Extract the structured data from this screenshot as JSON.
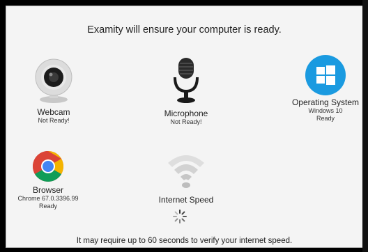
{
  "title": "Examity will ensure your computer is ready.",
  "checks": {
    "webcam": {
      "label": "Webcam",
      "status": "Not Ready!"
    },
    "microphone": {
      "label": "Microphone",
      "status": "Not Ready!"
    },
    "os": {
      "label": "Operating System",
      "detail": "Windows 10",
      "status": "Ready"
    },
    "browser": {
      "label": "Browser",
      "detail": "Chrome 67.0.3396.99",
      "status": "Ready"
    },
    "internet": {
      "label": "Internet Speed"
    }
  },
  "footer": "It may require up to 60 seconds to verify your internet speed.",
  "colors": {
    "os_tile": "#1a9ae0",
    "background": "#f4f4f4"
  },
  "icons": [
    "webcam-icon",
    "microphone-icon",
    "windows-icon",
    "chrome-icon",
    "wifi-icon",
    "spinner-icon"
  ]
}
